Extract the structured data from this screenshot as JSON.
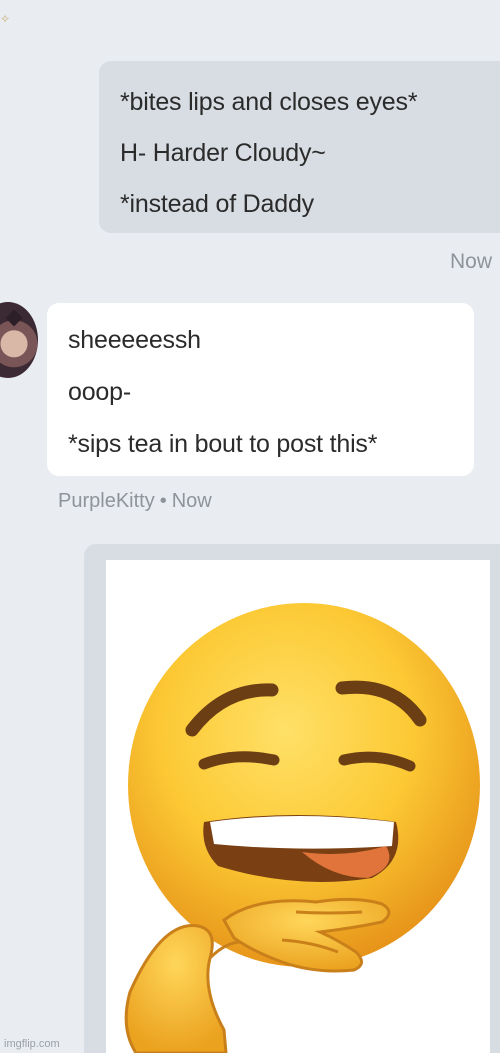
{
  "thread": {
    "outgoing": {
      "lines": [
        "*bites lips and closes eyes*",
        "H- Harder Cloudy~",
        "*instead of Daddy"
      ],
      "time": "Now"
    },
    "incoming": {
      "lines": [
        "sheeeeessh",
        "ooop-",
        "*sips tea in bout to post this*"
      ],
      "sender": "PurpleKitty",
      "separator": "•",
      "time": "Now"
    },
    "image_message": {
      "subject": "lip-biting emoji with hands"
    }
  },
  "watermark": "imgflip.com",
  "colors": {
    "page_bg": "#e9ecf0",
    "outgoing_bubble": "#d7dde3",
    "incoming_bubble": "#ffffff",
    "meta_text": "#8e949a"
  }
}
